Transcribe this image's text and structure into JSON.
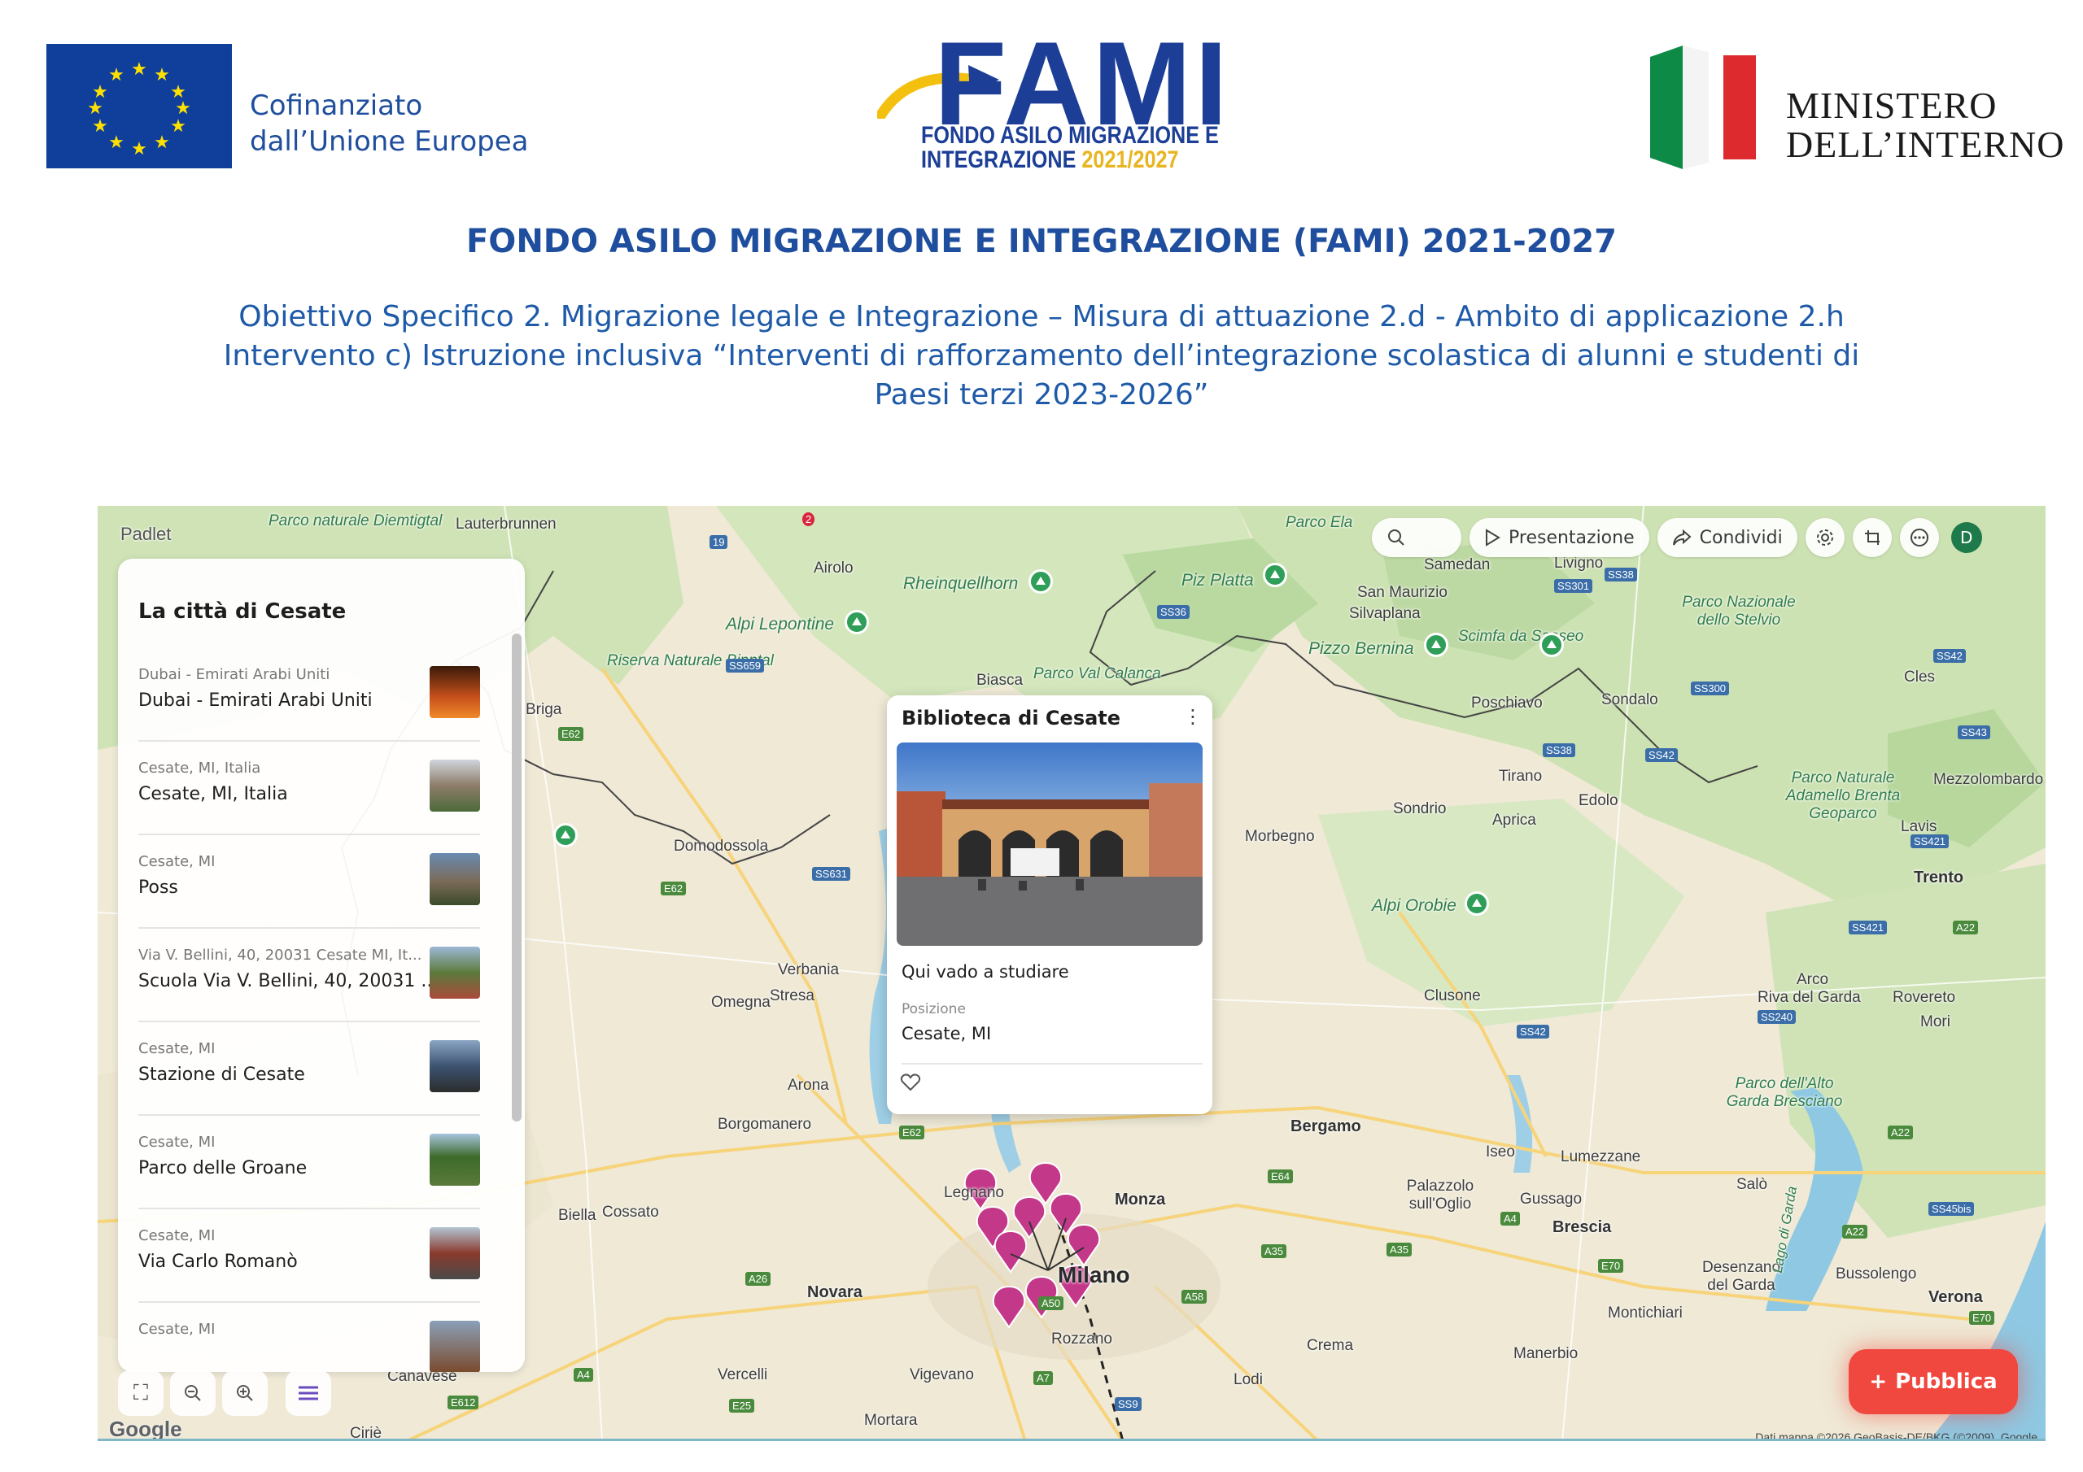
{
  "header": {
    "eu_text_line1": "Cofinanziato",
    "eu_text_line2": "dall’Unione Europea",
    "fami_word": "FAMI",
    "fami_sub1": "FONDO ASILO MIGRAZIONE E",
    "fami_sub2_a": "INTEGRAZIONE ",
    "fami_sub2_b": "2021/2027",
    "ministero_line1": "MINISTERO",
    "ministero_line2": "DELL’INTERNO",
    "title": "FONDO ASILO MIGRAZIONE E INTEGRAZIONE (FAMI) 2021-2027",
    "subtitle_line1": "Obiettivo Specifico 2. Migrazione legale e Integrazione – Misura di attuazione 2.d - Ambito di applicazione 2.h",
    "subtitle_line2": "Intervento c) Istruzione inclusiva “Interventi di rafforzamento dell’integrazione scolastica di alunni e studenti di",
    "subtitle_line3": "Paesi terzi 2023-2026”"
  },
  "toolbar": {
    "presentazione": "Presentazione",
    "condividi": "Condividi",
    "avatar": "D"
  },
  "sidebar": {
    "title": "La città di Cesate",
    "items": [
      {
        "sub": "Dubai - Emirati Arabi Uniti",
        "main": "Dubai - Emirati Arabi Uniti"
      },
      {
        "sub": "Cesate, MI, Italia",
        "main": "Cesate, MI, Italia"
      },
      {
        "sub": "Cesate, MI",
        "main": "Poss"
      },
      {
        "sub": "Via V. Bellini, 40, 20031 Cesate MI, It...",
        "main": "Scuola Via V. Bellini, 40, 20031 ..."
      },
      {
        "sub": "Cesate, MI",
        "main": "Stazione di Cesate"
      },
      {
        "sub": "Cesate, MI",
        "main": "Parco delle Groane"
      },
      {
        "sub": "Cesate, MI",
        "main": "Via Carlo Romanò"
      },
      {
        "sub": "Cesate, MI",
        "main": ""
      }
    ]
  },
  "card": {
    "title": "Biblioteca di Cesate",
    "caption": "Qui vado a studiare",
    "label": "Posizione",
    "value": "Cesate, MI"
  },
  "publish": "Pubblica",
  "map_labels": {
    "padlet": "Padlet",
    "google": "Google",
    "copyright": "Dati mappa ©2026 GeoBasis-DE/BKG (©2009), Google",
    "places": [
      "Parco naturale Diemtigtal",
      "Lauterbrunnen",
      "Airolo",
      "Rheinquellhorn",
      "Alpi Lepontine",
      "Riserva Naturale Binntal",
      "Biasca",
      "Parco Val Calanca",
      "Piz Platta",
      "Parco Ela",
      "Samedan",
      "San Maurizio",
      "Silvaplana",
      "Pizzo Bernina",
      "Scimfa da Saoseo",
      "Livigno",
      "Parco Nazionale dello Stelvio",
      "Poschiavo",
      "Sondalo",
      "Cles",
      "Tirano",
      "Edolo",
      "Sondrio",
      "Aprica",
      "Morbegno",
      "Parco Naturale Adamello Brenta Geoparco",
      "Mezzolombardo",
      "Lavis",
      "Trento",
      "Domodossola",
      "Alpi Orobie",
      "Verbania",
      "Omegna",
      "Stresa",
      "Clusone",
      "Arco",
      "Riva del Garda",
      "Rovereto",
      "Mori",
      "Arona",
      "Borgomanero",
      "Parco dell'Alto Garda Bresciano",
      "Bergamo",
      "Iseo",
      "Lumezzane",
      "Legnano",
      "Monza",
      "Palazzolo sull'Oglio",
      "Gussago",
      "Brescia",
      "Salò",
      "Biella",
      "Cossato",
      "Milano",
      "Novara",
      "Desenzano del Garda",
      "Bussolengo",
      "Verona",
      "Montichiari",
      "Rozzano",
      "Crema",
      "Manerbio",
      "Vercelli",
      "Vigevano",
      "Lodi",
      "Mortara",
      "Ciriè",
      "Canavese",
      "Briga",
      "Lago di Garda"
    ]
  },
  "colors": {
    "brand_blue": "#1e4e9d",
    "publish_red": "#f0473f",
    "pin_magenta": "#c4388a"
  }
}
